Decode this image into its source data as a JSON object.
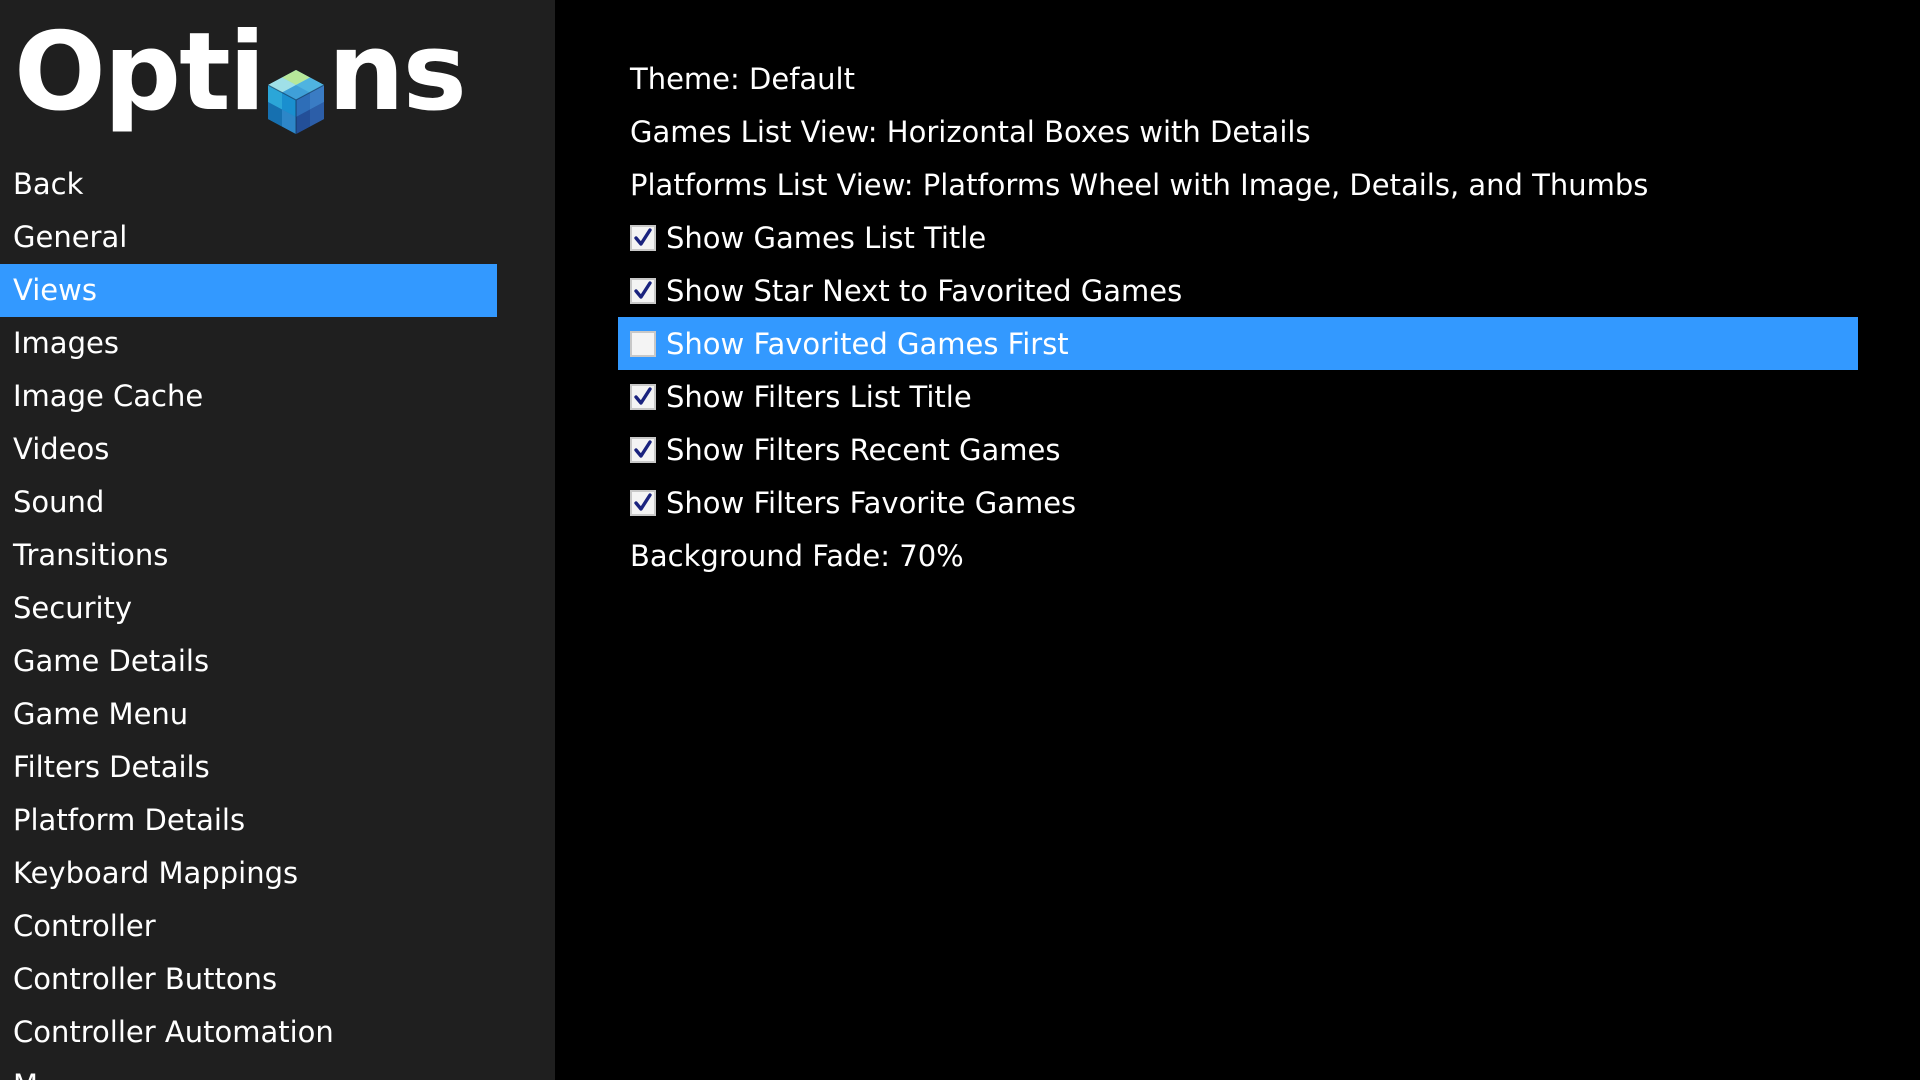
{
  "logo": {
    "text_before": "Opti",
    "text_after": "ns",
    "icon": "cube-logo-icon"
  },
  "sidebar": {
    "items": [
      {
        "label": "Back"
      },
      {
        "label": "General"
      },
      {
        "label": "Views",
        "selected": true
      },
      {
        "label": "Images"
      },
      {
        "label": "Image Cache"
      },
      {
        "label": "Videos"
      },
      {
        "label": "Sound"
      },
      {
        "label": "Transitions"
      },
      {
        "label": "Security"
      },
      {
        "label": "Game Details"
      },
      {
        "label": "Game Menu"
      },
      {
        "label": "Filters Details"
      },
      {
        "label": "Platform Details"
      },
      {
        "label": "Keyboard Mappings"
      },
      {
        "label": "Controller"
      },
      {
        "label": "Controller Buttons"
      },
      {
        "label": "Controller Automation"
      },
      {
        "label": "M..."
      }
    ]
  },
  "options": {
    "items": [
      {
        "label": "Theme: Default",
        "type": "value"
      },
      {
        "label": "Games List View: Horizontal Boxes with Details",
        "type": "value"
      },
      {
        "label": "Platforms List View: Platforms Wheel with Image, Details, and Thumbs",
        "type": "value"
      },
      {
        "label": "Show Games List Title",
        "type": "checkbox",
        "checked": true
      },
      {
        "label": "Show Star Next to Favorited Games",
        "type": "checkbox",
        "checked": true
      },
      {
        "label": "Show Favorited Games First",
        "type": "checkbox",
        "checked": false,
        "selected": true
      },
      {
        "label": "Show Filters List Title",
        "type": "checkbox",
        "checked": true
      },
      {
        "label": "Show Filters Recent Games",
        "type": "checkbox",
        "checked": true
      },
      {
        "label": "Show Filters Favorite Games",
        "type": "checkbox",
        "checked": true
      },
      {
        "label": "Background Fade: 70%",
        "type": "value"
      }
    ]
  },
  "colors": {
    "sidebar_bg": "#1f1f1f",
    "main_bg": "#000000",
    "selection": "#3399ff",
    "text": "#ffffff",
    "check_mark": "#1a237e"
  }
}
